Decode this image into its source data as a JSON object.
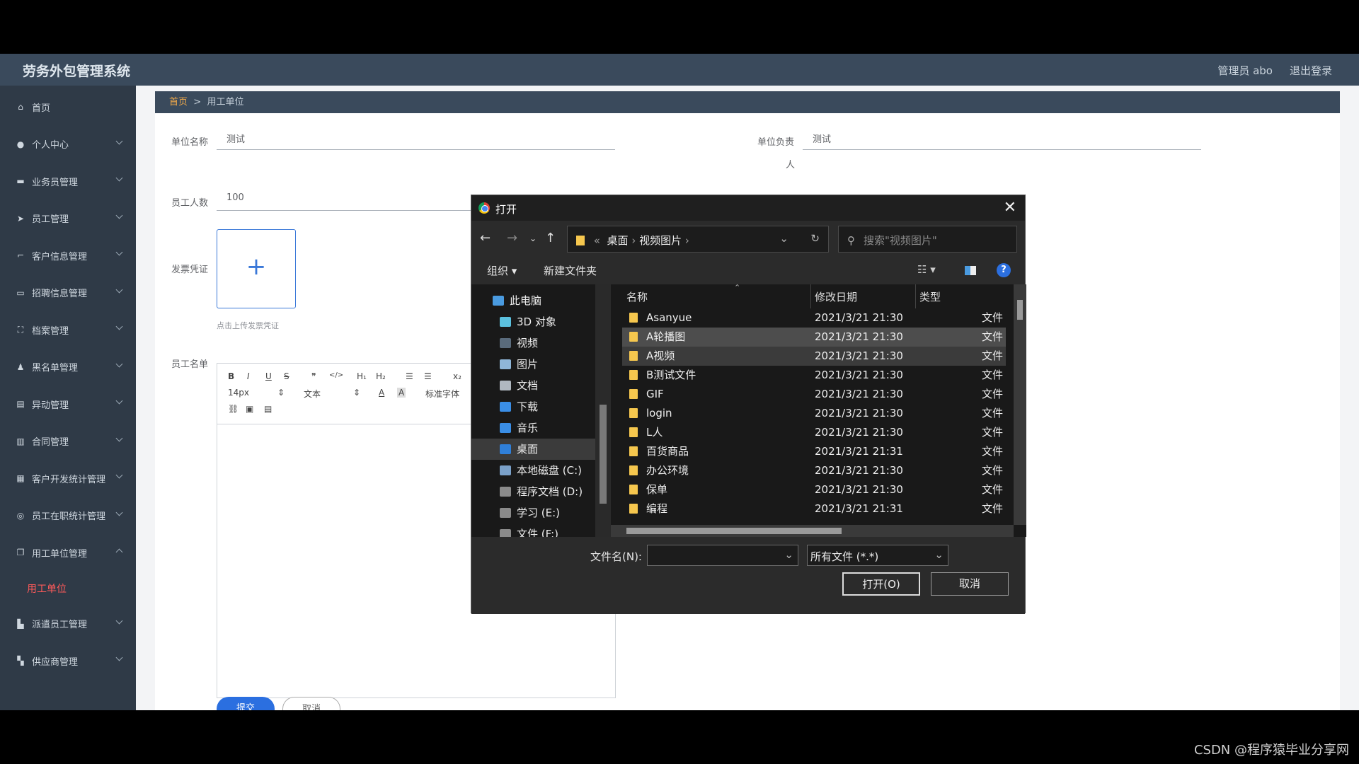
{
  "app": {
    "title": "劳务外包管理系统",
    "user": "管理员 abo",
    "logout": "退出登录"
  },
  "sidebar": {
    "items": [
      {
        "label": "首页",
        "icon": "home-icon"
      },
      {
        "label": "个人中心",
        "icon": "user-icon"
      },
      {
        "label": "业务员管理",
        "icon": "chat-icon"
      },
      {
        "label": "员工管理",
        "icon": "send-icon"
      },
      {
        "label": "客户信息管理",
        "icon": "crop-icon"
      },
      {
        "label": "招聘信息管理",
        "icon": "message-icon"
      },
      {
        "label": "档案管理",
        "icon": "fullscreen-icon"
      },
      {
        "label": "黑名单管理",
        "icon": "person-icon"
      },
      {
        "label": "异动管理",
        "icon": "clipboard-icon"
      },
      {
        "label": "合同管理",
        "icon": "bar-icon"
      },
      {
        "label": "客户开发统计管理",
        "icon": "grid-icon"
      },
      {
        "label": "员工在职统计管理",
        "icon": "compass-icon"
      },
      {
        "label": "用工单位管理",
        "icon": "copy-icon"
      },
      {
        "label": "派遣员工管理",
        "icon": "truck-icon"
      },
      {
        "label": "供应商管理",
        "icon": "car-icon"
      }
    ],
    "sub_active": "用工单位"
  },
  "breadcrumb": {
    "home": "首页",
    "sep": ">",
    "current": "用工单位"
  },
  "form": {
    "unit_name_label": "单位名称",
    "unit_name_value": "测试",
    "unit_head_label": "单位负责",
    "unit_head_label2": "人",
    "unit_head_value": "测试",
    "staff_count_label": "员工人数",
    "staff_count_value": "100",
    "invoice_label": "发票凭证",
    "upload_plus": "+",
    "upload_hint": "点击上传发票凭证",
    "staff_list_label": "员工名单",
    "editor": {
      "bold": "B",
      "italic": "I",
      "underline": "U",
      "strike": "S",
      "quote": "❞",
      "code": "</>",
      "h1": "H₁",
      "h2": "H₂",
      "ol": "☰",
      "ul": "☰",
      "sub": "x₂",
      "size": "14px",
      "para": "文本",
      "color": "A",
      "bg": "A",
      "font": "标准字体",
      "link": "🔗",
      "image": "▣",
      "video": "▤"
    },
    "submit": "提交",
    "cancel": "取消"
  },
  "dialog": {
    "title": "打开",
    "path": {
      "sep": "«",
      "seg1": "桌面",
      "seg2": "视频图片"
    },
    "search_placeholder": "搜索\"视频图片\"",
    "organize": "组织 ▾",
    "new_folder": "新建文件夹",
    "nav": [
      {
        "label": "此电脑",
        "color": "#4a9be0"
      },
      {
        "label": "3D 对象",
        "color": "#5bc0de"
      },
      {
        "label": "视频",
        "color": "#5a6b7c"
      },
      {
        "label": "图片",
        "color": "#8fb6d8"
      },
      {
        "label": "文档",
        "color": "#b0b8c0"
      },
      {
        "label": "下载",
        "color": "#3a8ee6"
      },
      {
        "label": "音乐",
        "color": "#3a8ee6"
      },
      {
        "label": "桌面",
        "color": "#2f7fd8"
      },
      {
        "label": "本地磁盘 (C:)",
        "color": "#7aa0c8"
      },
      {
        "label": "程序文档 (D:)",
        "color": "#8a8a8a"
      },
      {
        "label": "学习 (E:)",
        "color": "#8a8a8a"
      },
      {
        "label": "文件 (F:)",
        "color": "#8a8a8a"
      }
    ],
    "columns": {
      "name": "名称",
      "date": "修改日期",
      "type": "类型"
    },
    "files": [
      {
        "name": "Asanyue",
        "date": "2021/3/21 21:30",
        "type": "文件"
      },
      {
        "name": "A轮播图",
        "date": "2021/3/21 21:30",
        "type": "文件"
      },
      {
        "name": "A视频",
        "date": "2021/3/21 21:30",
        "type": "文件"
      },
      {
        "name": "B测试文件",
        "date": "2021/3/21 21:30",
        "type": "文件"
      },
      {
        "name": "GIF",
        "date": "2021/3/21 21:30",
        "type": "文件"
      },
      {
        "name": "login",
        "date": "2021/3/21 21:30",
        "type": "文件"
      },
      {
        "name": "L人",
        "date": "2021/3/21 21:30",
        "type": "文件"
      },
      {
        "name": "百货商品",
        "date": "2021/3/21 21:31",
        "type": "文件"
      },
      {
        "name": "办公环境",
        "date": "2021/3/21 21:30",
        "type": "文件"
      },
      {
        "name": "保单",
        "date": "2021/3/21 21:30",
        "type": "文件"
      },
      {
        "name": "编程",
        "date": "2021/3/21 21:31",
        "type": "文件"
      }
    ],
    "filename_label": "文件名(N):",
    "filename_value": "",
    "filter": "所有文件 (*.*)",
    "open": "打开(O)",
    "cancel": "取消"
  },
  "watermark": "CSDN @程序猿毕业分享网"
}
